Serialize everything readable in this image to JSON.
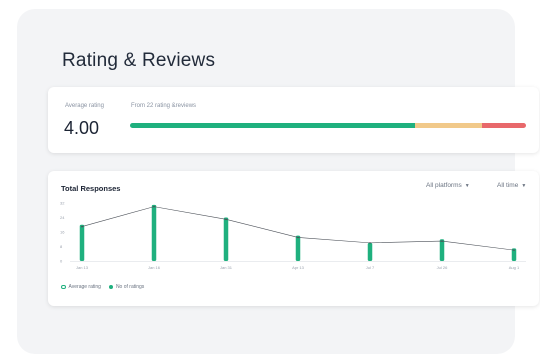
{
  "header": {
    "title": "Rating & Reviews"
  },
  "rating": {
    "average_label": "Average rating",
    "average_value": "4.00",
    "reviews_label": "From 22 rating &reviews",
    "bar": [
      {
        "name": "positive",
        "fraction": 0.72,
        "color": "#1fb07e"
      },
      {
        "name": "neutral",
        "fraction": 0.17,
        "color": "#f1c98a"
      },
      {
        "name": "negative",
        "fraction": 0.11,
        "color": "#e8686b"
      }
    ]
  },
  "responses": {
    "title": "Total Responses",
    "platform_filter": "All platforms",
    "time_filter": "All time",
    "caret_icon": "chevron-down-icon",
    "legend": [
      {
        "label": "Average rating",
        "color": "#1fb07e",
        "icon": "hollow-dot-icon"
      },
      {
        "label": "No of ratings",
        "color": "#1fb07e",
        "icon": "filled-dot-icon"
      }
    ]
  },
  "chart_data": {
    "type": "bar",
    "title": "Total Responses",
    "categories": [
      "Jan 13",
      "Jan 16",
      "Jan 31",
      "Apr 13",
      "Jul 7",
      "Jul 26",
      "Aug 1"
    ],
    "series": [
      {
        "name": "No of ratings",
        "values": [
          20,
          31,
          24,
          14,
          10,
          12,
          7
        ]
      },
      {
        "name": "Average rating",
        "values": [
          19,
          30,
          23,
          13,
          10,
          11,
          6
        ]
      }
    ],
    "y_ticks": [
      0,
      8,
      16,
      24,
      32
    ],
    "ylim": [
      0,
      32
    ],
    "grid": false,
    "colors": {
      "bar": "#1fb07e",
      "line": "#4a4f57",
      "axis": "#e3e6ea"
    }
  }
}
